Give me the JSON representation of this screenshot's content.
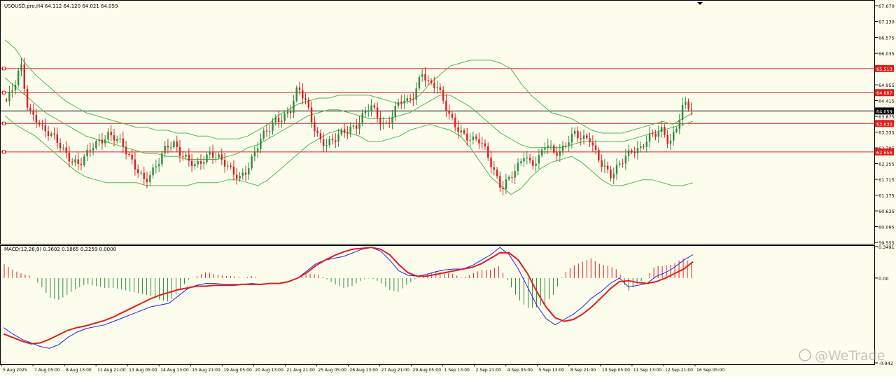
{
  "window": {
    "symbol_header": "USOUSD.pro,H4  64.112 64.120 64.021 64.059",
    "macd_header": "MACD(12,26,9) 0.3602 0.1865 0.2259 0.0000",
    "watermark_text": "@WeTrade",
    "watermark_icon": "wetrade-logo-icon"
  },
  "colors": {
    "background": "#FDFDEE",
    "frame": "#000000",
    "bull": "#2E8B3A",
    "bear": "#E31C1C",
    "bands": "#4CB84C",
    "level_line": "#E31C1C",
    "current_price_line": "#000000",
    "macd_line": "#2020E8",
    "signal_line": "#E31C1C",
    "hist_pos": "#E31C1C",
    "hist_neg": "#2E8B3A"
  },
  "chart_data": [
    {
      "type": "candlestick",
      "symbol": "USOUSD.pro",
      "timeframe": "H4",
      "ohlc_last": {
        "open": 64.112,
        "high": 64.12,
        "low": 64.021,
        "close": 64.059
      },
      "ylim": [
        59.555,
        67.67
      ],
      "y_ticks": [
        "67.670",
        "67.130",
        "66.575",
        "66.035",
        "65.495",
        "64.955",
        "64.415",
        "63.875",
        "63.335",
        "62.795",
        "62.255",
        "61.715",
        "61.175",
        "60.635",
        "60.095",
        "59.555"
      ],
      "x_ticks": [
        "5 Aug 2025",
        "7 Aug 05:00",
        "8 Aug 13:00",
        "11 Aug 21:00",
        "13 Aug 05:00",
        "14 Aug 13:00",
        "15 Aug 21:00",
        "19 Aug 05:00",
        "20 Aug 13:00",
        "21 Aug 21:00",
        "25 Aug 05:00",
        "26 Aug 13:00",
        "27 Aug 21:00",
        "29 Aug 05:00",
        "1 Sep 13:00",
        "2 Sep 21:00",
        "4 Sep 05:00",
        "5 Sep 13:00",
        "8 Sep 21:00",
        "10 Sep 05:00",
        "11 Sep 13:00",
        "12 Sep 21:00",
        "16 Sep 05:00"
      ],
      "close_path": [
        64.4,
        64.8,
        65.6,
        64.1,
        63.9,
        63.4,
        63.2,
        63.0,
        62.7,
        62.4,
        62.2,
        62.5,
        62.9,
        63.1,
        63.3,
        63.1,
        62.8,
        62.4,
        62.1,
        61.7,
        61.9,
        62.3,
        62.9,
        63.0,
        62.6,
        62.3,
        62.1,
        62.4,
        62.7,
        62.5,
        62.2,
        61.9,
        61.8,
        62.1,
        62.6,
        63.1,
        63.4,
        63.8,
        63.9,
        64.1,
        64.8,
        64.4,
        63.7,
        63.1,
        62.9,
        63.0,
        63.3,
        63.5,
        63.6,
        63.9,
        64.2,
        63.8,
        63.6,
        64.0,
        64.4,
        64.3,
        64.6,
        65.5,
        65.0,
        64.9,
        64.3,
        63.8,
        63.5,
        63.2,
        63.0,
        63.0,
        62.6,
        62.0,
        61.4,
        61.7,
        62.0,
        62.6,
        62.3,
        62.4,
        62.9,
        62.6,
        62.7,
        63.1,
        63.3,
        63.0,
        63.1,
        62.6,
        62.2,
        61.8,
        62.1,
        62.5,
        62.8,
        62.8,
        63.1,
        63.2,
        63.4,
        63.0,
        63.6,
        64.3,
        64.06
      ],
      "bb_upper": [
        66.5,
        66.2,
        65.7,
        65.3,
        65.0,
        64.7,
        64.4,
        64.2,
        64.0,
        63.9,
        63.8,
        63.7,
        63.6,
        63.5,
        63.5,
        63.4,
        63.4,
        63.3,
        63.3,
        63.2,
        63.2,
        63.1,
        63.1,
        63.1,
        63.2,
        63.4,
        63.6,
        63.9,
        64.1,
        64.3,
        64.4,
        64.5,
        64.5,
        64.6,
        64.6,
        64.6,
        64.6,
        64.5,
        64.4,
        64.3,
        64.4,
        64.6,
        65.0,
        65.3,
        65.6,
        65.7,
        65.8,
        65.8,
        65.8,
        65.7,
        65.5,
        65.0,
        64.6,
        64.3,
        64.0,
        63.9,
        63.8,
        63.6,
        63.4,
        63.3,
        63.3,
        63.3,
        63.4,
        63.5,
        63.6,
        63.7,
        63.6,
        63.8,
        64.0
      ],
      "bb_mid": [
        65.2,
        64.9,
        64.6,
        64.3,
        64.0,
        63.8,
        63.6,
        63.4,
        63.2,
        63.1,
        63.0,
        62.9,
        62.8,
        62.7,
        62.6,
        62.6,
        62.5,
        62.5,
        62.4,
        62.4,
        62.4,
        62.4,
        62.5,
        62.6,
        62.8,
        62.9,
        63.1,
        63.3,
        63.5,
        63.7,
        63.9,
        64.0,
        64.1,
        64.1,
        64.0,
        63.9,
        63.8,
        63.8,
        63.8,
        63.9,
        64.0,
        64.2,
        64.4,
        64.6,
        64.6,
        64.4,
        64.2,
        63.9,
        63.6,
        63.3,
        63.1,
        62.9,
        62.8,
        62.8,
        62.8,
        62.8,
        62.9,
        63.0,
        63.0,
        63.0,
        63.0,
        63.0,
        63.1,
        63.2,
        63.3,
        63.4,
        63.5,
        63.6,
        63.7
      ],
      "bb_lower": [
        63.9,
        63.6,
        63.4,
        63.2,
        62.9,
        62.6,
        62.3,
        62.0,
        61.8,
        61.7,
        61.6,
        61.6,
        61.6,
        61.6,
        61.5,
        61.5,
        61.5,
        61.5,
        61.5,
        61.6,
        61.6,
        61.6,
        61.7,
        61.7,
        61.6,
        61.5,
        61.7,
        62.0,
        62.3,
        62.6,
        62.9,
        63.1,
        63.3,
        63.4,
        63.3,
        63.2,
        63.0,
        63.0,
        63.1,
        63.2,
        63.4,
        63.5,
        63.6,
        63.5,
        63.4,
        63.2,
        62.8,
        62.3,
        61.8,
        61.5,
        61.2,
        61.4,
        61.8,
        62.1,
        62.3,
        62.4,
        62.5,
        62.3,
        62.0,
        61.7,
        61.5,
        61.5,
        61.6,
        61.7,
        61.7,
        61.6,
        61.5,
        61.5,
        61.6
      ],
      "level_lines": [
        {
          "price": 65.513,
          "label": "65.513",
          "color": "#E31C1C"
        },
        {
          "price": 64.687,
          "label": "64.687",
          "color": "#E31C1C"
        },
        {
          "price": 63.63,
          "label": "63.630",
          "color": "#E31C1C"
        },
        {
          "price": 62.656,
          "label": "62.656",
          "color": "#E31C1C"
        }
      ],
      "current_price": {
        "price": 64.059,
        "label": "64.059"
      }
    },
    {
      "type": "macd",
      "params": "12,26,9",
      "ylim": [
        -0.942,
        0.3491
      ],
      "y_ticks": [
        "0.3491",
        "0.00",
        "-0.942"
      ],
      "macd": [
        -0.55,
        -0.62,
        -0.68,
        -0.72,
        -0.76,
        -0.78,
        -0.74,
        -0.66,
        -0.6,
        -0.56,
        -0.54,
        -0.52,
        -0.48,
        -0.44,
        -0.4,
        -0.36,
        -0.32,
        -0.3,
        -0.28,
        -0.2,
        -0.12,
        -0.08,
        -0.06,
        -0.06,
        -0.07,
        -0.07,
        -0.07,
        -0.06,
        -0.07,
        -0.06,
        -0.06,
        -0.04,
        0.0,
        0.08,
        0.16,
        0.2,
        0.22,
        0.24,
        0.28,
        0.32,
        0.34,
        0.3,
        0.2,
        0.08,
        0.03,
        0.02,
        0.04,
        0.07,
        0.09,
        0.1,
        0.1,
        0.14,
        0.2,
        0.26,
        0.34,
        0.26,
        0.1,
        -0.1,
        -0.3,
        -0.45,
        -0.52,
        -0.46,
        -0.4,
        -0.32,
        -0.22,
        -0.15,
        -0.06,
        0.0,
        -0.1,
        -0.08,
        -0.06,
        0.02,
        0.06,
        0.12,
        0.2,
        0.26
      ],
      "signal": [
        -0.62,
        -0.66,
        -0.7,
        -0.73,
        -0.72,
        -0.68,
        -0.63,
        -0.58,
        -0.55,
        -0.53,
        -0.5,
        -0.47,
        -0.43,
        -0.38,
        -0.33,
        -0.28,
        -0.23,
        -0.19,
        -0.16,
        -0.13,
        -0.11,
        -0.09,
        -0.09,
        -0.08,
        -0.08,
        -0.08,
        -0.07,
        -0.07,
        -0.07,
        -0.06,
        -0.06,
        -0.04,
        0.0,
        0.06,
        0.14,
        0.2,
        0.25,
        0.29,
        0.32,
        0.33,
        0.34,
        0.32,
        0.26,
        0.15,
        0.06,
        0.02,
        0.02,
        0.04,
        0.06,
        0.08,
        0.1,
        0.12,
        0.16,
        0.22,
        0.28,
        0.28,
        0.2,
        0.05,
        -0.15,
        -0.32,
        -0.44,
        -0.48,
        -0.46,
        -0.4,
        -0.32,
        -0.22,
        -0.12,
        -0.04,
        -0.03,
        -0.05,
        -0.06,
        -0.04,
        0.0,
        0.05,
        0.1,
        0.18
      ]
    }
  ]
}
